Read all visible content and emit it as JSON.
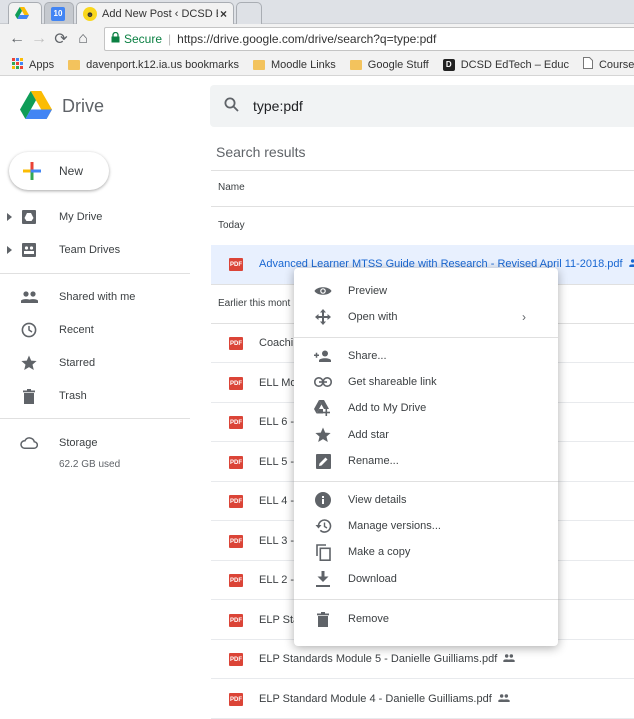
{
  "browser": {
    "tabs": [
      {
        "label": ""
      },
      {
        "label": "10"
      },
      {
        "label": "Add New Post ‹ DCSD Ed"
      }
    ],
    "tab_close": "×",
    "secure_label": "Secure",
    "url": "https://drive.google.com/drive/search?q=type:pdf",
    "bookmarks": [
      {
        "label": "Apps"
      },
      {
        "label": "davenport.k12.ia.us bookmarks"
      },
      {
        "label": "Moodle Links"
      },
      {
        "label": "Google Stuff"
      },
      {
        "label": "DCSD EdTech – Educ"
      },
      {
        "label": "CourseWhere - Logo"
      }
    ]
  },
  "drive": {
    "logo_text": "Drive",
    "search_query": "type:pdf",
    "new_label": "New",
    "sidebar": [
      {
        "label": "My Drive",
        "icon": "my-drive-icon"
      },
      {
        "label": "Team Drives",
        "icon": "team-drives-icon"
      },
      {
        "label": "Shared with me",
        "icon": "people-icon"
      },
      {
        "label": "Recent",
        "icon": "clock-icon"
      },
      {
        "label": "Starred",
        "icon": "star-icon"
      },
      {
        "label": "Trash",
        "icon": "trash-icon"
      }
    ],
    "storage": {
      "label": "Storage",
      "used": "62.2 GB used"
    }
  },
  "results": {
    "title": "Search results",
    "col_name": "Name",
    "group_today": "Today",
    "group_earlier": "Earlier this mont",
    "files": [
      {
        "name": "Advanced Learner MTSS Guide with Research - Revised April 11-2018.pdf",
        "shared": true,
        "selected": true
      },
      {
        "name": "Coachin",
        "shared": false
      },
      {
        "name": "ELL Mo",
        "shared": false
      },
      {
        "name": "ELL 6 -",
        "shared": false
      },
      {
        "name": "ELL 5 -",
        "shared": false
      },
      {
        "name": "ELL 4 -",
        "shared": false
      },
      {
        "name": "ELL 3 -",
        "shared": false
      },
      {
        "name": "ELL 2 -",
        "shared": false
      },
      {
        "name": "ELP Sta",
        "shared": false
      },
      {
        "name": "ELP Standards Module 5 - Danielle Guilliams.pdf",
        "shared": true
      },
      {
        "name": "ELP Standard Module 4 - Danielle Guilliams.pdf",
        "shared": true
      }
    ]
  },
  "context_menu": {
    "items": [
      {
        "label": "Preview",
        "icon": "eye-icon"
      },
      {
        "label": "Open with",
        "icon": "move-icon",
        "submenu": "›"
      },
      {
        "label": "Share...",
        "icon": "person-add-icon"
      },
      {
        "label": "Get shareable link",
        "icon": "link-icon"
      },
      {
        "label": "Add to My Drive",
        "icon": "drive-add-icon"
      },
      {
        "label": "Add star",
        "icon": "star-icon"
      },
      {
        "label": "Rename...",
        "icon": "edit-icon"
      },
      {
        "label": "View details",
        "icon": "info-icon"
      },
      {
        "label": "Manage versions...",
        "icon": "history-icon"
      },
      {
        "label": "Make a copy",
        "icon": "copy-icon"
      },
      {
        "label": "Download",
        "icon": "download-icon"
      },
      {
        "label": "Remove",
        "icon": "trash-icon"
      }
    ]
  },
  "colors": {
    "selected_bg": "#e8f0fe",
    "selected_text": "#1967d2",
    "pdf_red": "#db4437",
    "secure_green": "#0b8043",
    "icon_gray": "#5f6368"
  }
}
